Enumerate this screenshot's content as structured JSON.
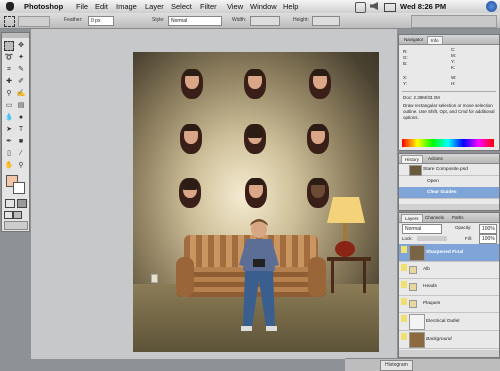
{
  "menubar": {
    "app_name": "Photoshop",
    "menus": [
      "File",
      "Edit",
      "Image",
      "Layer",
      "Select",
      "Filter",
      "View",
      "Window",
      "Help"
    ],
    "clock": "Wed 8:26 PM"
  },
  "options_bar": {
    "feather_label": "Feather:",
    "feather_value": "0 px",
    "style_label": "Style:",
    "style_value": "Normal",
    "width_label": "Width:",
    "height_label": "Height:"
  },
  "info_panel": {
    "tabs": [
      "Navigator",
      "Info"
    ],
    "rgb_labels": [
      "R:",
      "G:",
      "B:"
    ],
    "cmyk_labels": [
      "C:",
      "M:",
      "Y:",
      "K:"
    ],
    "xy_labels": [
      "X:",
      "Y:"
    ],
    "wh_labels": [
      "W:",
      "H:"
    ],
    "doc_text": "Doc: 2.39M/33.2M",
    "hint_text": "Draw rectangular selection or move selection outline. Use Shift, Opt, and Cmd for additional options."
  },
  "history_panel": {
    "tabs": [
      "History",
      "Actions"
    ],
    "snapshot": "Stare Composite.psd",
    "items": [
      "Open",
      "Clear Guides"
    ]
  },
  "layers_panel": {
    "tabs": [
      "Layers",
      "Channels",
      "Paths"
    ],
    "blend_mode": "Normal",
    "opacity_label": "Opacity:",
    "opacity_value": "100%",
    "lock_label": "Lock:",
    "fill_label": "Fill:",
    "fill_value": "100%",
    "layers": [
      "Sharpened Final",
      "Alb",
      "Heads",
      "Plaques",
      "Electrical Outlet",
      "Background"
    ]
  },
  "status_bar": {
    "text": "Histogram"
  }
}
